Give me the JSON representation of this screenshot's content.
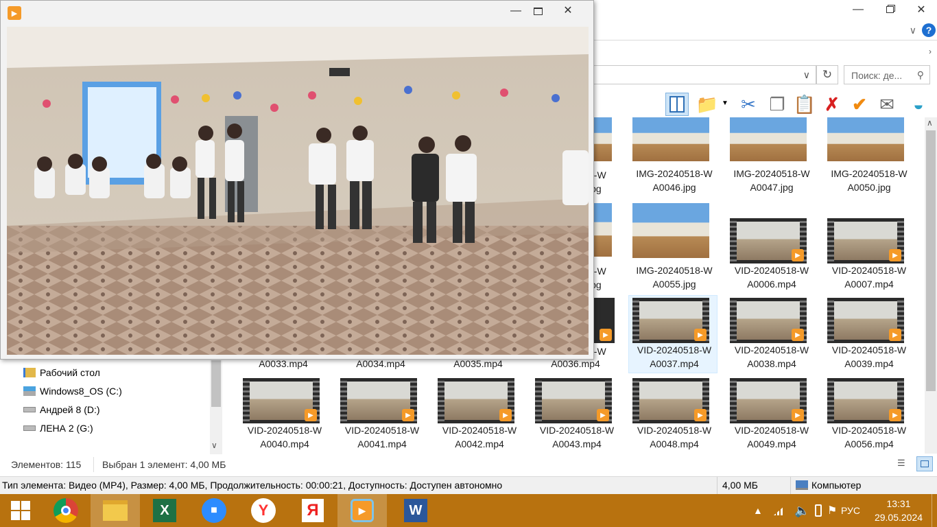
{
  "explorer": {
    "search_placeholder": "Поиск: де...",
    "status": {
      "count": "Элементов: 115",
      "selection": "Выбран 1 элемент: 4,00 МБ"
    },
    "details": {
      "info": "Тип элемента: Видео (MP4), Размер: 4,00 МБ, Продолжительность: 00:00:21, Доступность: Доступен автономно",
      "size": "4,00 МБ",
      "location": "Компьютер"
    },
    "nav_items": [
      {
        "label": "Рабочий стол",
        "icon": "folder-icon"
      },
      {
        "label": "Windows8_OS (C:)",
        "icon": "drive-icon"
      },
      {
        "label": "Андрей 8 (D:)",
        "icon": "drive-icon"
      },
      {
        "label": "ЛЕНА 2 (G:)",
        "icon": "drive-icon"
      }
    ],
    "partial_captions": {
      "row1": "8-W",
      "row1b": "jpg",
      "row2": "8-W",
      "row2b": "jpg",
      "row3": "8-W"
    },
    "row3_captions_line2": [
      "A0033.mp4",
      "A0034.mp4",
      "A0035.mp4",
      "A0036.mp4"
    ],
    "files_row1": [
      {
        "l1": "IMG-20240518-W",
        "l2": "A0046.jpg",
        "type": "photo"
      },
      {
        "l1": "IMG-20240518-W",
        "l2": "A0047.jpg",
        "type": "photo"
      },
      {
        "l1": "IMG-20240518-W",
        "l2": "A0050.jpg",
        "type": "photo"
      }
    ],
    "files_row2": [
      {
        "l1": "IMG-20240518-W",
        "l2": "A0055.jpg",
        "type": "photo"
      },
      {
        "l1": "VID-20240518-W",
        "l2": "A0006.mp4",
        "type": "video"
      },
      {
        "l1": "VID-20240518-W",
        "l2": "A0007.mp4",
        "type": "video"
      }
    ],
    "files_row3": [
      {
        "l1": "VID-20240518-W",
        "l2": "A0037.mp4",
        "type": "video",
        "selected": true
      },
      {
        "l1": "VID-20240518-W",
        "l2": "A0038.mp4",
        "type": "video"
      },
      {
        "l1": "VID-20240518-W",
        "l2": "A0039.mp4",
        "type": "video"
      }
    ],
    "files_row4": [
      {
        "l1": "VID-20240518-W",
        "l2": "A0040.mp4",
        "type": "video"
      },
      {
        "l1": "VID-20240518-W",
        "l2": "A0041.mp4",
        "type": "video"
      },
      {
        "l1": "VID-20240518-W",
        "l2": "A0042.mp4",
        "type": "video"
      },
      {
        "l1": "VID-20240518-W",
        "l2": "A0043.mp4",
        "type": "video"
      },
      {
        "l1": "VID-20240518-W",
        "l2": "A0048.mp4",
        "type": "video"
      },
      {
        "l1": "VID-20240518-W",
        "l2": "A0049.mp4",
        "type": "video"
      },
      {
        "l1": "VID-20240518-W",
        "l2": "A0056.mp4",
        "type": "video"
      }
    ]
  },
  "taskbar": {
    "lang": "РУС",
    "time": "13:31",
    "date": "29.05.2024"
  },
  "colors": {
    "taskbar": "#b8720f",
    "selection": "#cce8ff",
    "play_badge": "#f59a28"
  }
}
